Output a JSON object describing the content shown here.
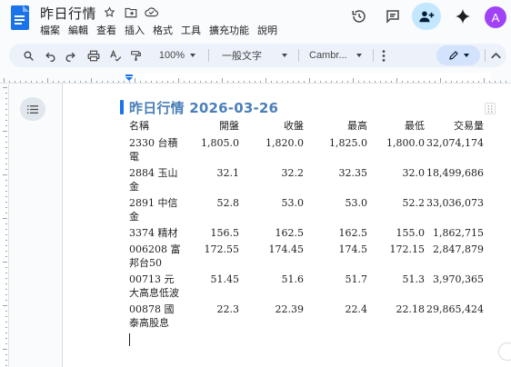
{
  "app": {
    "title": "昨日行情",
    "menu": [
      "檔案",
      "編輯",
      "查看",
      "插入",
      "格式",
      "工具",
      "擴充功能",
      "說明"
    ],
    "avatar_letter": "A",
    "accent_color": "#1a73e8"
  },
  "toolbar": {
    "zoom": "100%",
    "style": "一般文字",
    "font": "Cambr...",
    "icons": [
      "search-icon",
      "undo-icon",
      "redo-icon",
      "print-icon",
      "spellcheck-icon",
      "paint-format-icon",
      "more-icon",
      "pen-icon",
      "chevron-up-icon"
    ]
  },
  "document": {
    "heading_title": "昨日行情",
    "heading_date": "2026-03-26",
    "heading_color": "#4a7fb8",
    "table": {
      "headers": [
        "名稱",
        "開盤",
        "收盤",
        "最高",
        "最低",
        "交易量"
      ],
      "rows": [
        [
          "2330 台積電",
          "1,805.0",
          "1,820.0",
          "1,825.0",
          "1,800.0",
          "32,074,174"
        ],
        [
          "2884 玉山金",
          "32.1",
          "32.2",
          "32.35",
          "32.0",
          "18,499,686"
        ],
        [
          "2891 中信金",
          "52.8",
          "53.0",
          "53.0",
          "52.2",
          "33,036,073"
        ],
        [
          "3374 精材",
          "156.5",
          "162.5",
          "162.5",
          "155.0",
          "1,862,715"
        ],
        [
          "006208 富邦台50",
          "172.55",
          "174.45",
          "174.5",
          "172.15",
          "2,847,879"
        ],
        [
          "00713 元大高息低波",
          "51.45",
          "51.6",
          "51.7",
          "51.3",
          "3,970,365"
        ],
        [
          "00878 國泰高股息",
          "22.3",
          "22.39",
          "22.4",
          "22.18",
          "29,865,424"
        ]
      ]
    }
  }
}
